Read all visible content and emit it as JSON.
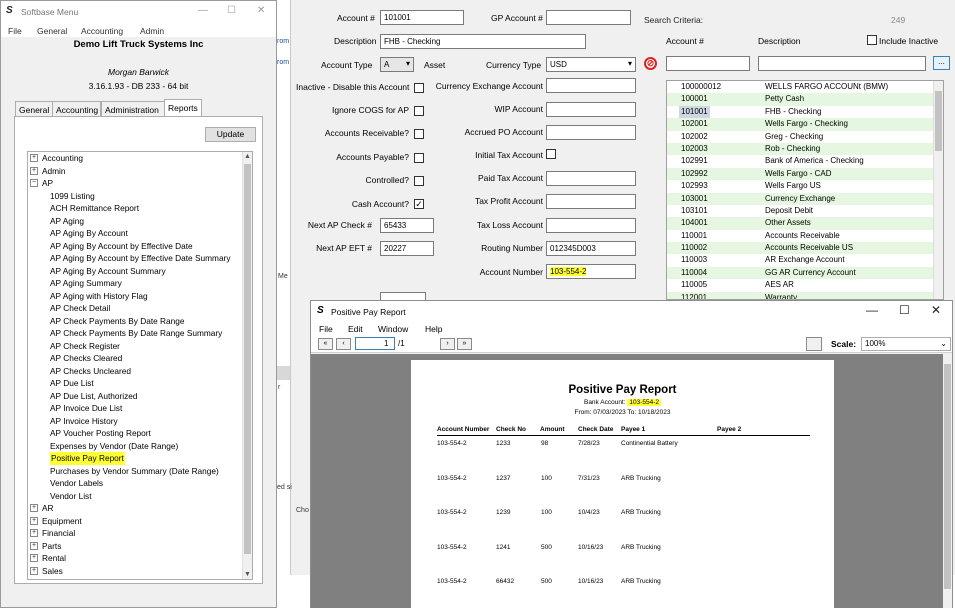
{
  "account_window": {
    "account_label": "Account #",
    "account_value": "101001",
    "gp_account_label": "GP Account #",
    "description_label": "Description",
    "description_value": "FHB - Checking",
    "account_type_label": "Account Type",
    "account_type_value": "A",
    "account_type_text": "Asset",
    "currency_type_label": "Currency Type",
    "currency_value": "USD",
    "inactive_label": "Inactive - Disable this Account",
    "ignore_cogs_label": "Ignore COGS for AP",
    "accounts_receivable_label": "Accounts Receivable?",
    "accounts_payable_label": "Accounts Payable?",
    "controlled_label": "Controlled?",
    "cash_account_label": "Cash Account?",
    "next_ap_check_label": "Next AP Check #",
    "next_ap_check_value": "65433",
    "next_ap_eft_label": "Next AP EFT #",
    "next_ap_eft_value": "20227",
    "currency_exchange_label": "Currency Exchange Account",
    "wip_label": "WIP Account",
    "accrued_po_label": "Accrued PO Account",
    "initial_tax_label": "Initial Tax Account",
    "paid_tax_label": "Paid Tax Account",
    "tax_profit_label": "Tax Profit Account",
    "tax_loss_label": "Tax Loss Account",
    "routing_label": "Routing Number",
    "routing_value": "012345D003",
    "account_number_label": "Account Number",
    "account_number_value": "103-554-2",
    "search_criteria_label": "Search Criteria:",
    "record_count": "249",
    "col_account": "Account #",
    "col_description": "Description",
    "include_inactive_label": "Include Inactive",
    "browse_button": "...",
    "accounts": [
      {
        "num": "100000012",
        "desc": "WELLS FARGO ACCOUNt (BMW)",
        "shade": false
      },
      {
        "num": "100001",
        "desc": "Petty Cash",
        "shade": true
      },
      {
        "num": "101001",
        "desc": "FHB - Checking",
        "shade": false,
        "selected": true
      },
      {
        "num": "102001",
        "desc": "Wells Fargo - Checking",
        "shade": true
      },
      {
        "num": "102002",
        "desc": "Greg - Checking",
        "shade": false
      },
      {
        "num": "102003",
        "desc": "Rob - Checking",
        "shade": true
      },
      {
        "num": "102991",
        "desc": "Bank of America - Checking",
        "shade": false
      },
      {
        "num": "102992",
        "desc": "Wells Fargo - CAD",
        "shade": true
      },
      {
        "num": "102993",
        "desc": "Wells Fargo US",
        "shade": false
      },
      {
        "num": "103001",
        "desc": "Currency Exchange",
        "shade": true
      },
      {
        "num": "103101",
        "desc": "Deposit Debit",
        "shade": false
      },
      {
        "num": "104001",
        "desc": "Other Assets",
        "shade": true
      },
      {
        "num": "110001",
        "desc": "Accounts Receivable",
        "shade": false
      },
      {
        "num": "110002",
        "desc": "Accounts Receivable US",
        "shade": true
      },
      {
        "num": "110003",
        "desc": "AR Exchange Account",
        "shade": false
      },
      {
        "num": "110004",
        "desc": "GG AR Currency Account",
        "shade": true
      },
      {
        "num": "110005",
        "desc": "AES AR",
        "shade": false
      },
      {
        "num": "112001",
        "desc": "Warranty",
        "shade": true
      }
    ]
  },
  "menu_window": {
    "title": "Softbase Menu",
    "menus": [
      "File",
      "General",
      "Accounting",
      "Admin"
    ],
    "company": "Demo Lift Truck Systems Inc",
    "user": "Morgan Barwick",
    "version": "3.16.1.93 - DB 233 - 64 bit",
    "tabs": [
      "General",
      "Accounting",
      "Administration",
      "Reports"
    ],
    "update_button": "Update",
    "tree_top": [
      {
        "label": "Accounting",
        "sign": "+"
      },
      {
        "label": "Admin",
        "sign": "+"
      },
      {
        "label": "AP",
        "sign": "−"
      }
    ],
    "ap_children": [
      "1099 Listing",
      "ACH Remittance Report",
      "AP Aging",
      "AP Aging By Account",
      "AP Aging By Account by Effective Date",
      "AP Aging By Account by Effective Date Summary",
      "AP Aging By Account Summary",
      "AP Aging Summary",
      "AP Aging with History Flag",
      "AP Check Detail",
      "AP Check Payments By Date Range",
      "AP Check Payments By Date Range Summary",
      "AP Check Register",
      "AP Checks Cleared",
      "AP Checks Uncleared",
      "AP Due List",
      "AP Due List, Authorized",
      "AP Invoice Due List",
      "AP Invoice History",
      "AP Voucher Posting Report",
      "Expenses by Vendor  (Date Range)",
      "Positive Pay Report",
      "Purchases by Vendor Summary (Date Range)",
      "Vendor Labels",
      "Vendor List"
    ],
    "highlighted_item": "Positive Pay Report",
    "tree_bottom": [
      {
        "label": "AR",
        "sign": "+"
      },
      {
        "label": "Equipment",
        "sign": "+"
      },
      {
        "label": "Financial",
        "sign": "+"
      },
      {
        "label": "Parts",
        "sign": "+"
      },
      {
        "label": "Rental",
        "sign": "+"
      },
      {
        "label": "Sales",
        "sign": "+"
      }
    ]
  },
  "positive_pay_window": {
    "title": "Positive Pay Report",
    "menus": [
      "File",
      "Edit",
      "Window",
      "Help"
    ],
    "page_current": "1",
    "page_total": "/1",
    "scale_label": "Scale:",
    "scale_value": "100%",
    "report": {
      "title": "Positive Pay Report",
      "bank_label": "Bank Account:",
      "bank_value": "103-554-2",
      "range_text": "From:  07/03/2023  To: 10/18/2023",
      "headers": [
        "Account Number",
        "Check No",
        "Amount",
        "Check Date",
        "Payee 1",
        "Payee 2"
      ],
      "rows": [
        [
          "103-554-2",
          "1233",
          "98",
          "7/28/23",
          "Continential Battery"
        ],
        [
          "103-554-2",
          "1237",
          "100",
          "7/31/23",
          "ARB Trucking"
        ],
        [
          "103-554-2",
          "1239",
          "100",
          "10/4/23",
          "ARB Trucking"
        ],
        [
          "103-554-2",
          "1241",
          "500",
          "10/16/23",
          "ARB Trucking"
        ],
        [
          "103-554-2",
          "66432",
          "500",
          "10/16/23",
          "ARB Trucking"
        ]
      ]
    }
  },
  "stubs": {
    "from1": "rom",
    "from2": "rom",
    "me": "Me",
    "r": "r",
    "ed": "ed si",
    "cho": "Cho"
  }
}
